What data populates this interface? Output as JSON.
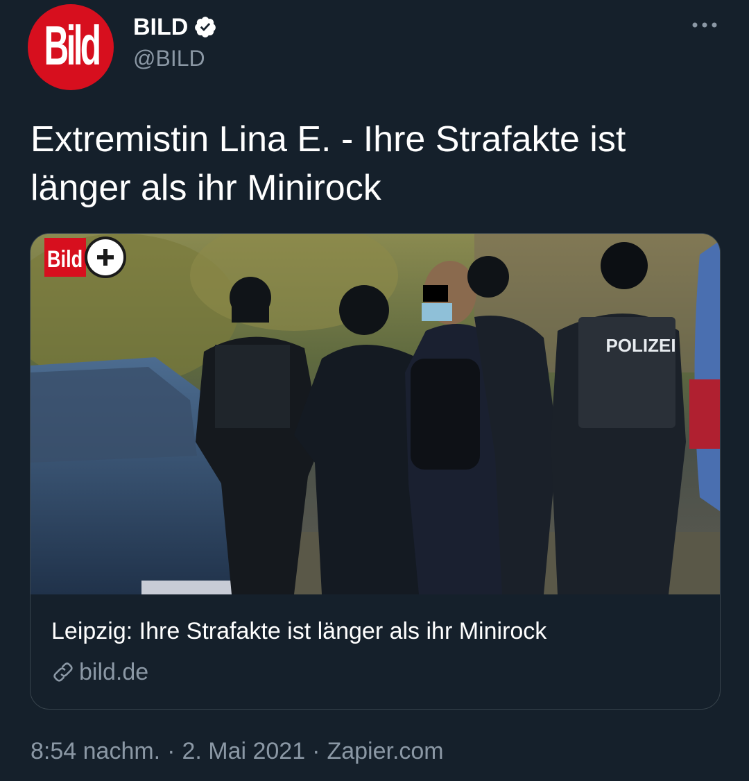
{
  "author": {
    "avatar_text": "Bild",
    "display_name": "BILD",
    "handle": "@BILD",
    "verified": true
  },
  "tweet": {
    "text": "Extremistin Lina E. - Ihre Strafakte ist länger als ihr Minirock"
  },
  "card": {
    "image_badge_text": "Bild",
    "image_vest_text": "POLIZEI",
    "title": "Leipzig: Ihre Strafakte ist länger als ihr Minirock",
    "domain": "bild.de"
  },
  "footer": {
    "time": "8:54 nachm.",
    "date": "2. Mai 2021",
    "source": "Zapier.com",
    "separator": "·"
  },
  "colors": {
    "background": "#15202b",
    "brand_red": "#d70f1e",
    "secondary_text": "#8b98a5",
    "border": "#38444d"
  },
  "icons": {
    "verified": "verified-badge-icon",
    "more": "more-options-icon",
    "link": "link-icon",
    "plus": "plus-icon"
  }
}
